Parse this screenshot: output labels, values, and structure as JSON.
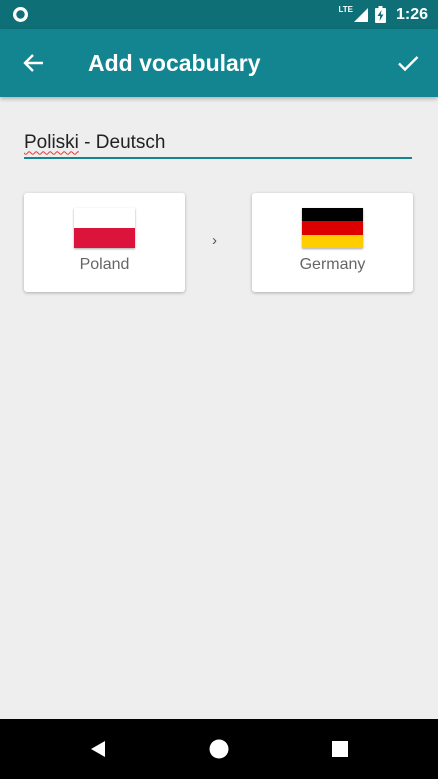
{
  "status_bar": {
    "network_type": "LTE",
    "time": "1:26"
  },
  "app_bar": {
    "title": "Add vocabulary",
    "back_icon": "arrow-back-icon",
    "confirm_icon": "check-icon"
  },
  "form": {
    "name_first_word": "Poliski",
    "name_rest": " - Deutsch"
  },
  "source_language": {
    "label": "Poland",
    "flag_colors": [
      "#ffffff",
      "#dc143c"
    ]
  },
  "target_language": {
    "label": "Germany",
    "flag_colors": [
      "#000000",
      "#dd0000",
      "#ffce00"
    ]
  },
  "separator": "›",
  "colors": {
    "status_bar": "#0e6f77",
    "app_bar": "#138591",
    "accent": "#138591",
    "background": "#eeeeee"
  }
}
